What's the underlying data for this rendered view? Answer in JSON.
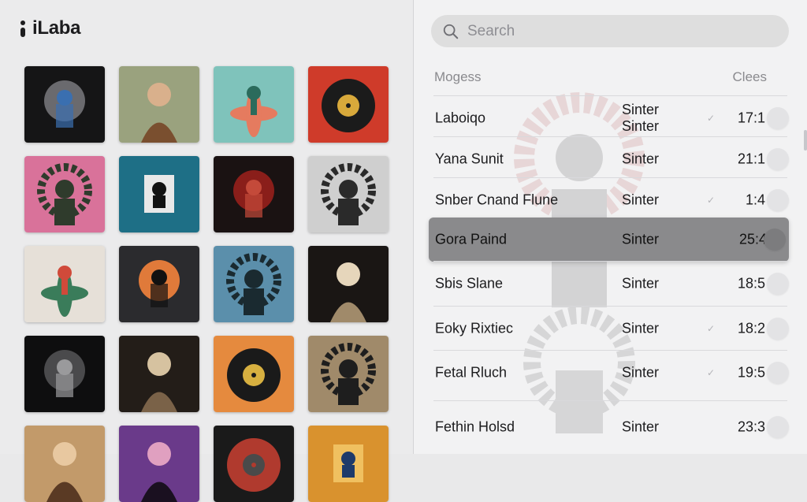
{
  "window": {
    "controls": [
      "close",
      "minimize",
      "zoom"
    ]
  },
  "brand": {
    "name": "iLaba",
    "icon": "app-logo-icon"
  },
  "albums": [
    {
      "scheme": "dark",
      "bg": "#151516",
      "fg": "#6a6a6e",
      "accent": "#3a6fb0",
      "motif": "figure"
    },
    {
      "scheme": "portrait",
      "bg": "#9aa27e",
      "fg": "#7a4f2f",
      "accent": "#d9b08c",
      "motif": "portrait"
    },
    {
      "scheme": "burst",
      "bg": "#7fc3bb",
      "fg": "#e57b5f",
      "accent": "#2b6b5c",
      "motif": "flower"
    },
    {
      "scheme": "record-red",
      "bg": "#cf3b2a",
      "fg": "#1b1b1b",
      "accent": "#d8a93b",
      "motif": "record"
    },
    {
      "scheme": "pink-burst",
      "bg": "#d9729a",
      "fg": "#2f3b2c",
      "accent": "#5fa36a",
      "motif": "gear"
    },
    {
      "scheme": "teal-frame",
      "bg": "#1e6f86",
      "fg": "#111",
      "accent": "#e8e8e8",
      "motif": "frame"
    },
    {
      "scheme": "red-dark",
      "bg": "#1a1212",
      "fg": "#8a1e1a",
      "accent": "#c44a3a",
      "motif": "figure"
    },
    {
      "scheme": "grey-gear",
      "bg": "#cfcfcf",
      "fg": "#2a2a2a",
      "accent": "#6a6a6a",
      "motif": "gear"
    },
    {
      "scheme": "cream-flower",
      "bg": "#e6e0d8",
      "fg": "#3a7c5a",
      "accent": "#d04a3a",
      "motif": "flower"
    },
    {
      "scheme": "orange-glow",
      "bg": "#2b2b2e",
      "fg": "#e07a3a",
      "accent": "#111",
      "motif": "figure"
    },
    {
      "scheme": "blue-fog",
      "bg": "#5b8fab",
      "fg": "#1a2a30",
      "accent": "#d6e2e8",
      "motif": "gear"
    },
    {
      "scheme": "dark-portrait",
      "bg": "#1a1614",
      "fg": "#a08a6a",
      "accent": "#e6d6bb",
      "motif": "portrait"
    },
    {
      "scheme": "black-glow",
      "bg": "#0e0e0f",
      "fg": "#4a4a4c",
      "accent": "#9a9a9c",
      "motif": "figure"
    },
    {
      "scheme": "dark-horns",
      "bg": "#231d18",
      "fg": "#7a6248",
      "accent": "#d6c2a0",
      "motif": "portrait"
    },
    {
      "scheme": "orange-record",
      "bg": "#e58a3e",
      "fg": "#1a1a1a",
      "accent": "#d7b040",
      "motif": "record"
    },
    {
      "scheme": "tan-gear",
      "bg": "#a08a6a",
      "fg": "#1e1e1e",
      "accent": "#e6ddd0",
      "motif": "gear"
    },
    {
      "scheme": "warm-face",
      "bg": "#c29a6a",
      "fg": "#5a3a24",
      "accent": "#e8c8a0",
      "motif": "portrait"
    },
    {
      "scheme": "purple",
      "bg": "#6a3a8a",
      "fg": "#1a1020",
      "accent": "#e0a0c0",
      "motif": "portrait"
    },
    {
      "scheme": "dark-red",
      "bg": "#1a1a1a",
      "fg": "#b03a2e",
      "accent": "#4a4a4a",
      "motif": "record"
    },
    {
      "scheme": "amber-frame",
      "bg": "#d9922e",
      "fg": "#1e3a6a",
      "accent": "#f0c060",
      "motif": "frame"
    }
  ],
  "search": {
    "placeholder": "Search",
    "value": ""
  },
  "table": {
    "col_name": "Mogess",
    "col_duration": "Clees",
    "rows": [
      {
        "title": "Laboiqo",
        "artist": "Sinter\nSinter",
        "time": "17:1",
        "check": true,
        "selected": false
      },
      {
        "title": "Yana Sunit",
        "artist": "Sinter",
        "time": "21:1",
        "check": false,
        "selected": false
      },
      {
        "title": "Snber Cnand Flune",
        "artist": "Sinter",
        "time": "1:4",
        "check": true,
        "selected": false
      },
      {
        "title": "Gora Paind",
        "artist": "Sinter",
        "time": "25:4",
        "check": false,
        "selected": true
      },
      {
        "title": "Sbis Slane",
        "artist": "Sinter",
        "time": "18:5",
        "check": false,
        "selected": false
      },
      {
        "title": "Eoky Rixtiec",
        "artist": "Sinter",
        "time": "18:2",
        "check": true,
        "selected": false
      },
      {
        "title": "Fetal Rluch",
        "artist": "Sinter",
        "time": "19:5",
        "check": true,
        "selected": false
      },
      {
        "title": "Fethin Holsd",
        "artist": "Sinter",
        "time": "23:3",
        "check": false,
        "selected": false
      }
    ]
  }
}
